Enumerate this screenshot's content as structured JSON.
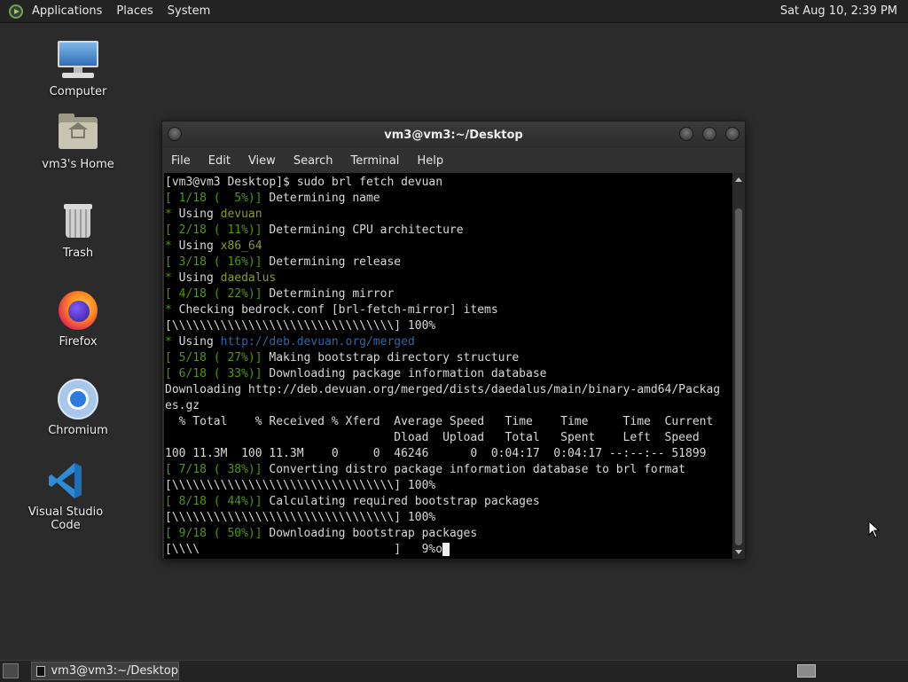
{
  "top_panel": {
    "menus": [
      "Applications",
      "Places",
      "System"
    ],
    "clock": "Sat Aug 10,  2:39 PM"
  },
  "desktop_icons": [
    {
      "label": "Computer",
      "icon": "computer-icon"
    },
    {
      "label": "vm3's Home",
      "icon": "home-folder-icon"
    },
    {
      "label": "Trash",
      "icon": "trash-icon"
    },
    {
      "label": "Firefox",
      "icon": "firefox-icon"
    },
    {
      "label": "Chromium",
      "icon": "chromium-icon"
    },
    {
      "label": "Visual Studio Code",
      "icon": "vscode-icon"
    }
  ],
  "terminal": {
    "title": "vm3@vm3:~/Desktop",
    "menu": [
      "File",
      "Edit",
      "View",
      "Search",
      "Terminal",
      "Help"
    ],
    "lines": [
      [
        {
          "t": "[vm3@vm3 Desktop]$ sudo brl fetch devuan",
          "c": ""
        }
      ],
      [
        {
          "t": "[ 1/18 (  5%)]",
          "c": "g"
        },
        {
          "t": " Determining name",
          "c": ""
        }
      ],
      [
        {
          "t": "* ",
          "c": "g"
        },
        {
          "t": "Using ",
          "c": ""
        },
        {
          "t": "devuan",
          "c": "y"
        }
      ],
      [
        {
          "t": "[ 2/18 ( 11%)]",
          "c": "g"
        },
        {
          "t": " Determining CPU architecture",
          "c": ""
        }
      ],
      [
        {
          "t": "* ",
          "c": "g"
        },
        {
          "t": "Using ",
          "c": ""
        },
        {
          "t": "x86_64",
          "c": "y"
        }
      ],
      [
        {
          "t": "[ 3/18 ( 16%)]",
          "c": "g"
        },
        {
          "t": " Determining release",
          "c": ""
        }
      ],
      [
        {
          "t": "* ",
          "c": "g"
        },
        {
          "t": "Using ",
          "c": ""
        },
        {
          "t": "daedalus",
          "c": "y"
        }
      ],
      [
        {
          "t": "[ 4/18 ( 22%)]",
          "c": "g"
        },
        {
          "t": " Determining mirror",
          "c": ""
        }
      ],
      [
        {
          "t": "* ",
          "c": "g"
        },
        {
          "t": "Checking bedrock.conf [brl-fetch-mirror] items",
          "c": ""
        }
      ],
      [
        {
          "t": "[\\\\\\\\\\\\\\\\\\\\\\\\\\\\\\\\\\\\\\\\\\\\\\\\\\\\\\\\\\\\\\\\] 100%",
          "c": ""
        }
      ],
      [
        {
          "t": "* ",
          "c": "g"
        },
        {
          "t": "Using ",
          "c": ""
        },
        {
          "t": "http://deb.devuan.org/merged",
          "c": "b"
        }
      ],
      [
        {
          "t": "[ 5/18 ( 27%)]",
          "c": "g"
        },
        {
          "t": " Making bootstrap directory structure",
          "c": ""
        }
      ],
      [
        {
          "t": "[ 6/18 ( 33%)]",
          "c": "g"
        },
        {
          "t": " Downloading package information database",
          "c": ""
        }
      ],
      [
        {
          "t": "Downloading http://deb.devuan.org/merged/dists/daedalus/main/binary-amd64/Packag",
          "c": ""
        }
      ],
      [
        {
          "t": "es.gz",
          "c": ""
        }
      ],
      [
        {
          "t": "  % Total    % Received % Xferd  Average Speed   Time    Time     Time  Current",
          "c": ""
        }
      ],
      [
        {
          "t": "                                 Dload  Upload   Total   Spent    Left  Speed",
          "c": ""
        }
      ],
      [
        {
          "t": "100 11.3M  100 11.3M    0     0  46246      0  0:04:17  0:04:17 --:--:-- 51899",
          "c": ""
        }
      ],
      [
        {
          "t": "[ 7/18 ( 38%)]",
          "c": "g"
        },
        {
          "t": " Converting distro package information database to brl format",
          "c": ""
        }
      ],
      [
        {
          "t": "[\\\\\\\\\\\\\\\\\\\\\\\\\\\\\\\\\\\\\\\\\\\\\\\\\\\\\\\\\\\\\\\\] 100%",
          "c": ""
        }
      ],
      [
        {
          "t": "[ 8/18 ( 44%)]",
          "c": "g"
        },
        {
          "t": " Calculating required bootstrap packages",
          "c": ""
        }
      ],
      [
        {
          "t": "[\\\\\\\\\\\\\\\\\\\\\\\\\\\\\\\\\\\\\\\\\\\\\\\\\\\\\\\\\\\\\\\\] 100%",
          "c": ""
        }
      ],
      [
        {
          "t": "[ 9/18 ( 50%)]",
          "c": "g"
        },
        {
          "t": " Downloading bootstrap packages",
          "c": ""
        }
      ],
      [
        {
          "t": "[\\\\\\\\                            ]   9%o",
          "c": ""
        },
        {
          "t": " ",
          "c": "cursor"
        }
      ]
    ]
  },
  "taskbar": {
    "window_button": "vm3@vm3:~/Desktop"
  }
}
